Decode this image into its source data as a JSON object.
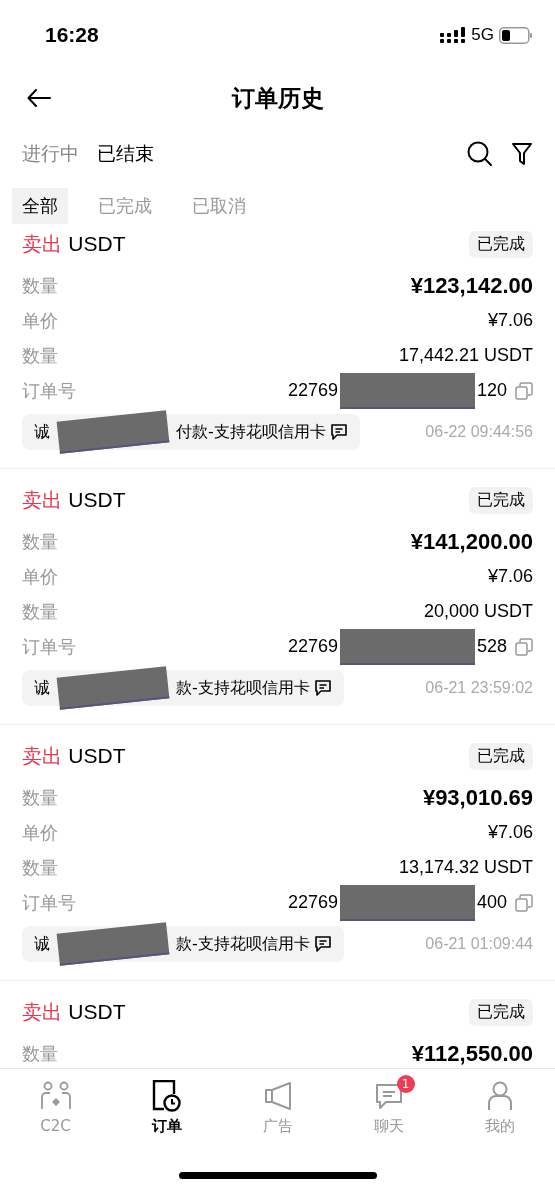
{
  "status_bar": {
    "time": "16:28",
    "network": "5G"
  },
  "header": {
    "title": "订单历史"
  },
  "tabs": [
    {
      "label": "进行中",
      "selected": false
    },
    {
      "label": "已结束",
      "selected": true
    }
  ],
  "sub_tabs": [
    {
      "label": "全部",
      "selected": true
    },
    {
      "label": "已完成",
      "selected": false
    },
    {
      "label": "已取消",
      "selected": false
    }
  ],
  "orders": [
    {
      "side": "卖出",
      "asset": "USDT",
      "status": "已完成",
      "rows": [
        {
          "label": "数量",
          "value": "¥123,142.00",
          "kind": "total"
        },
        {
          "label": "单价",
          "value": "¥7.06",
          "kind": "plain"
        },
        {
          "label": "数量",
          "value": "17,442.21 USDT",
          "kind": "plain"
        },
        {
          "label": "订单号",
          "value_start": "22769",
          "value_end": "120",
          "kind": "order_id"
        }
      ],
      "remark_start": "诚",
      "remark_end": "付款-支持花呗信用卡",
      "time": "06-22 09:44:56"
    },
    {
      "side": "卖出",
      "asset": "USDT",
      "status": "已完成",
      "rows": [
        {
          "label": "数量",
          "value": "¥141,200.00",
          "kind": "total"
        },
        {
          "label": "单价",
          "value": "¥7.06",
          "kind": "plain"
        },
        {
          "label": "数量",
          "value": "20,000 USDT",
          "kind": "plain"
        },
        {
          "label": "订单号",
          "value_start": "22769",
          "value_end": "528",
          "kind": "order_id"
        }
      ],
      "remark_start": "诚",
      "remark_end": "款-支持花呗信用卡",
      "time": "06-21 23:59:02"
    },
    {
      "side": "卖出",
      "asset": "USDT",
      "status": "已完成",
      "rows": [
        {
          "label": "数量",
          "value": "¥93,010.69",
          "kind": "total"
        },
        {
          "label": "单价",
          "value": "¥7.06",
          "kind": "plain"
        },
        {
          "label": "数量",
          "value": "13,174.32 USDT",
          "kind": "plain"
        },
        {
          "label": "订单号",
          "value_start": "22769",
          "value_end": "400",
          "kind": "order_id"
        }
      ],
      "remark_start": "诚",
      "remark_end": "款-支持花呗信用卡",
      "time": "06-21 01:09:44"
    },
    {
      "side": "卖出",
      "asset": "USDT",
      "status": "已完成",
      "rows": [
        {
          "label": "数量",
          "value": "¥112,550.00",
          "kind": "total"
        }
      ]
    }
  ],
  "bottom_nav": [
    {
      "label": "C2C",
      "selected": false,
      "kind": "c2c"
    },
    {
      "label": "订单",
      "selected": true,
      "kind": "orders"
    },
    {
      "label": "广告",
      "selected": false,
      "kind": "ads"
    },
    {
      "label": "聊天",
      "selected": false,
      "kind": "chat",
      "badge": "1"
    },
    {
      "label": "我的",
      "selected": false,
      "kind": "me"
    }
  ]
}
